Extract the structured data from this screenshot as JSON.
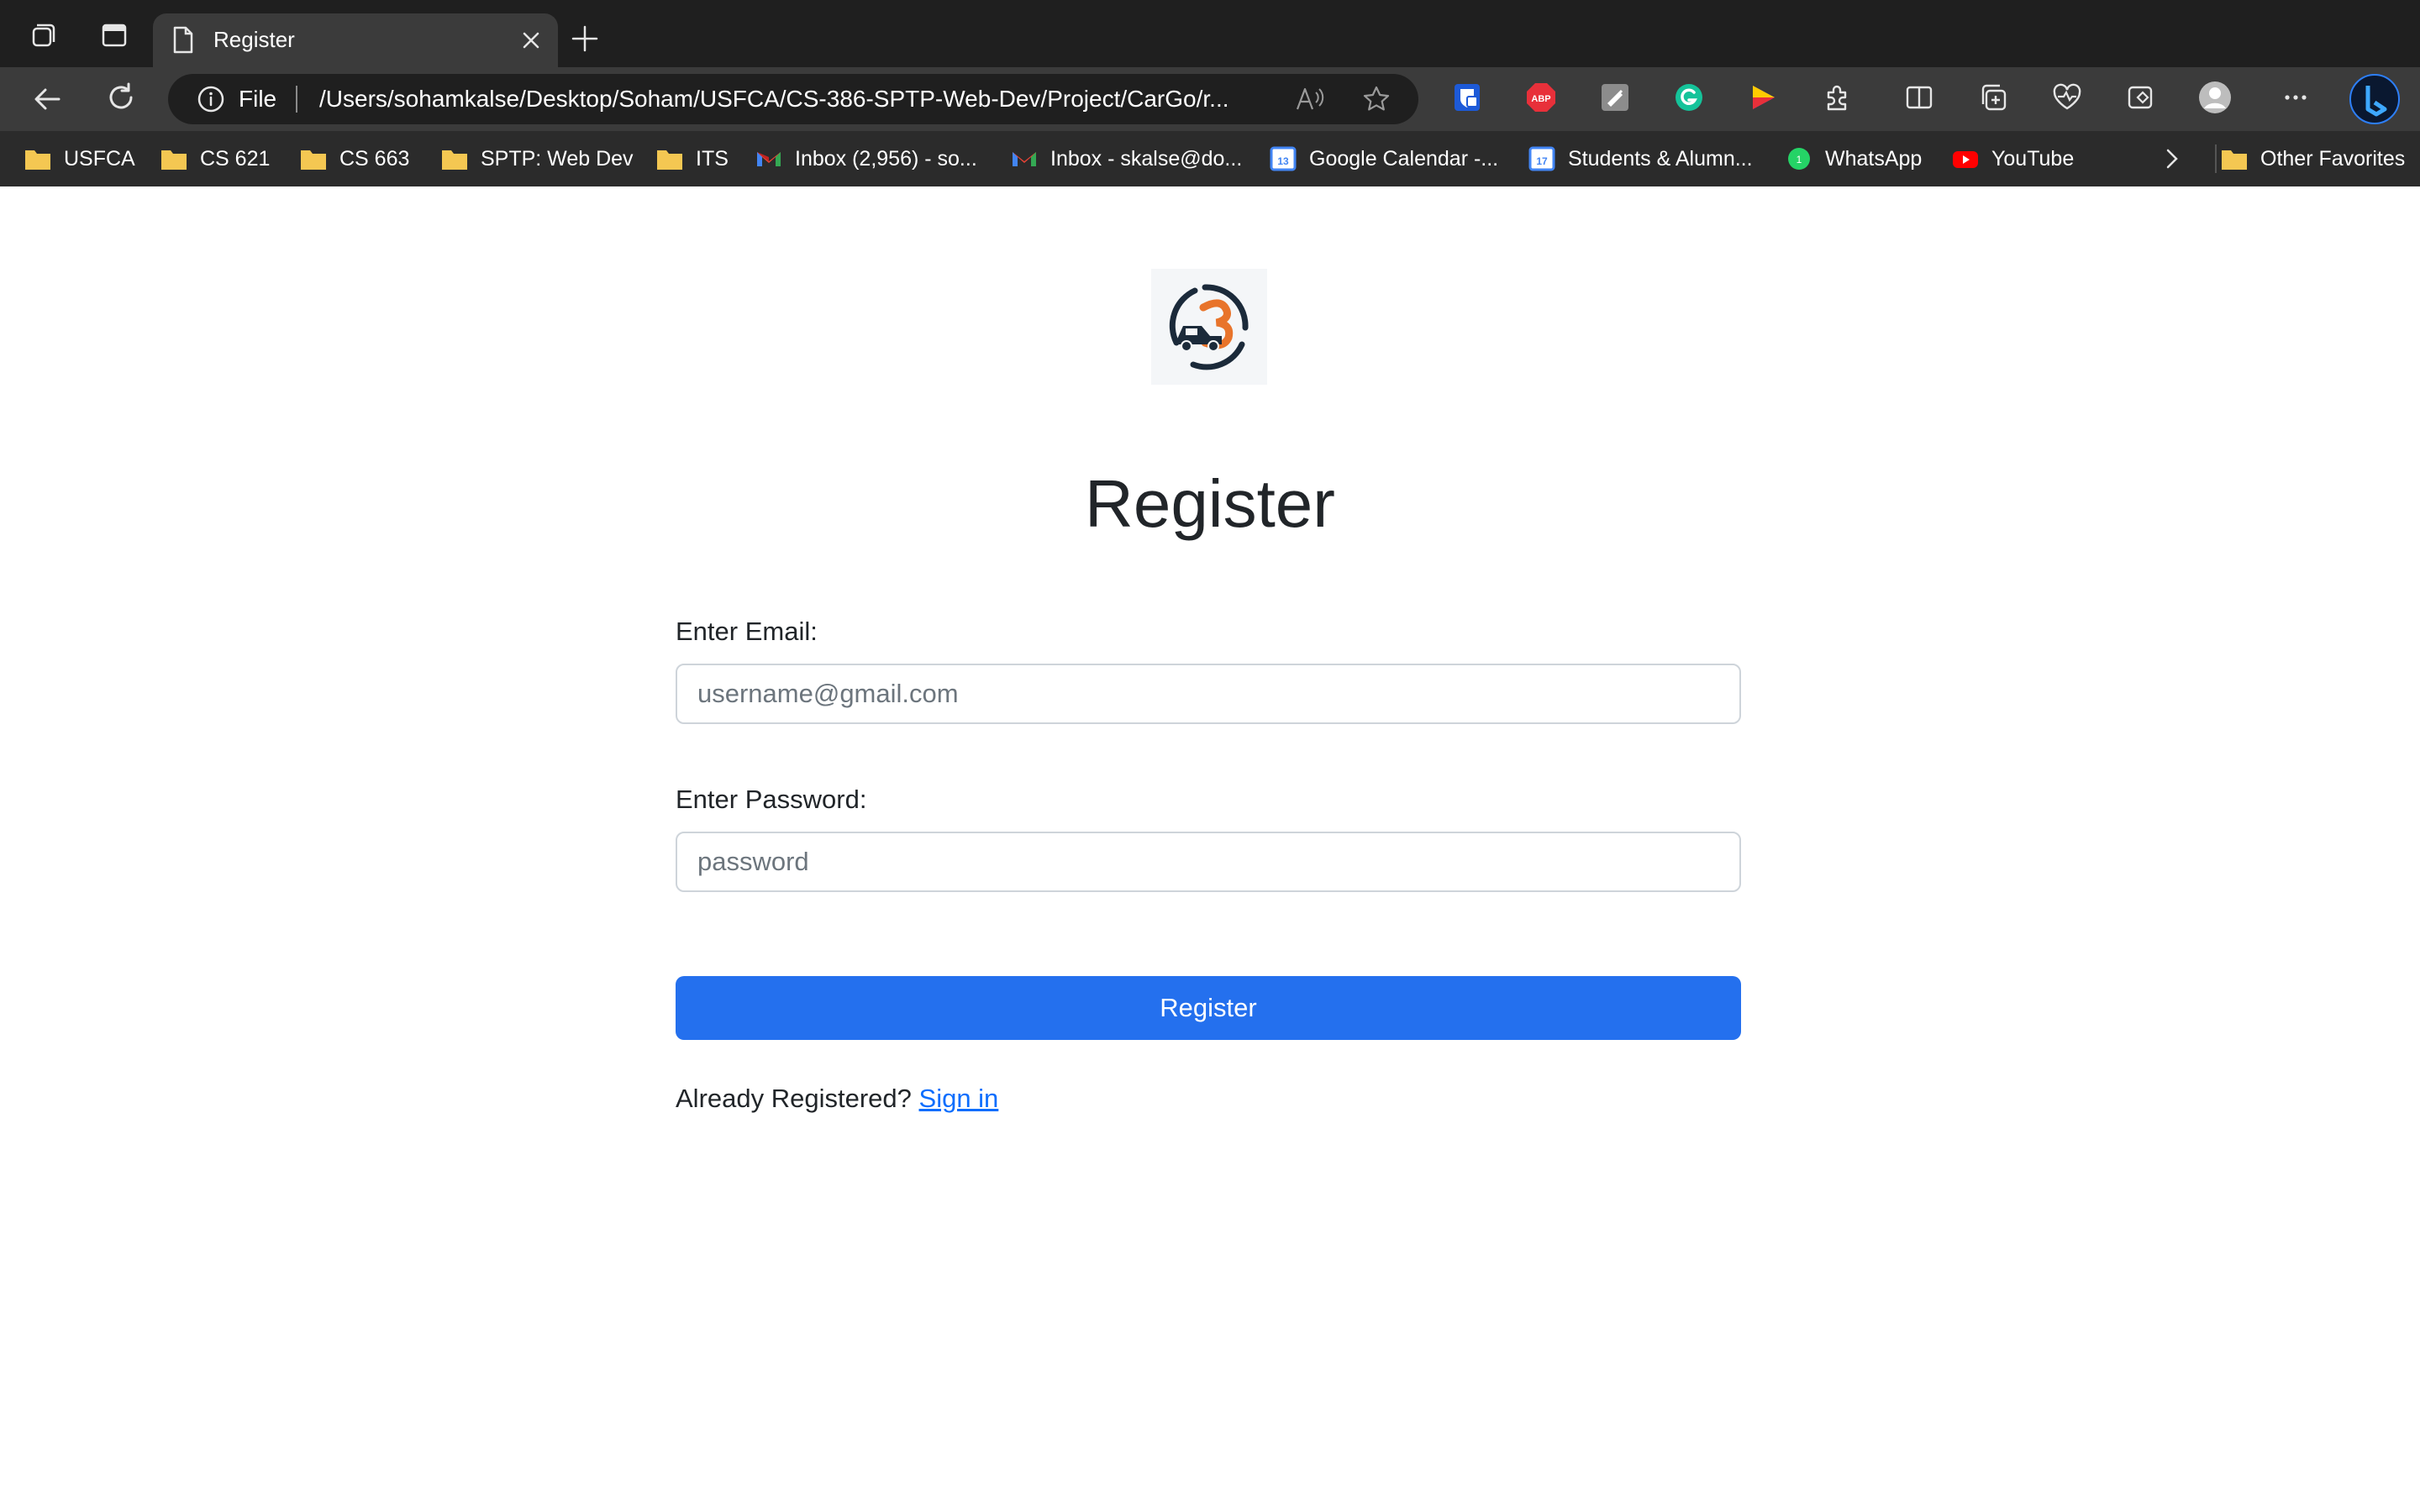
{
  "browser": {
    "tab_title": "Register",
    "address": {
      "scheme": "File",
      "url": "/Users/sohamkalse/Desktop/Soham/USFCA/CS-386-SPTP-Web-Dev/Project/CarGo/r..."
    },
    "extensions": [
      "bitwarden-icon",
      "adblock-plus-icon",
      "notes-extension-icon",
      "grammarly-icon",
      "colorful-extension-icon",
      "extensions-icon",
      "split-screen-icon",
      "collections-icon",
      "browser-essentials-icon",
      "copilot-icon",
      "profile-avatar",
      "more-icon",
      "bing-icon"
    ],
    "bookmarks": [
      {
        "label": "USFCA",
        "icon": "folder-icon"
      },
      {
        "label": "CS 621",
        "icon": "folder-icon"
      },
      {
        "label": "CS 663",
        "icon": "folder-icon"
      },
      {
        "label": "SPTP: Web Dev",
        "icon": "folder-icon"
      },
      {
        "label": "ITS",
        "icon": "folder-icon"
      },
      {
        "label": "Inbox (2,956) - so...",
        "icon": "gmail-icon"
      },
      {
        "label": "Inbox - skalse@do...",
        "icon": "gmail-icon"
      },
      {
        "label": "Google Calendar -...",
        "icon": "calendar-icon"
      },
      {
        "label": "Students & Alumn...",
        "icon": "calendar-icon"
      },
      {
        "label": "WhatsApp",
        "icon": "whatsapp-icon"
      },
      {
        "label": "YouTube",
        "icon": "youtube-icon"
      }
    ],
    "other_favorites": "Other Favorites"
  },
  "page": {
    "title": "Register",
    "email_label": "Enter Email:",
    "email_placeholder": "username@gmail.com",
    "password_label": "Enter Password:",
    "password_placeholder": "password",
    "submit_label": "Register",
    "signin_prompt": "Already Registered?",
    "signin_link": "Sign in"
  },
  "colors": {
    "primary": "#2470ee",
    "link": "#0d6efd",
    "logo_orange": "#e8742b",
    "logo_navy": "#1b2a3a"
  }
}
